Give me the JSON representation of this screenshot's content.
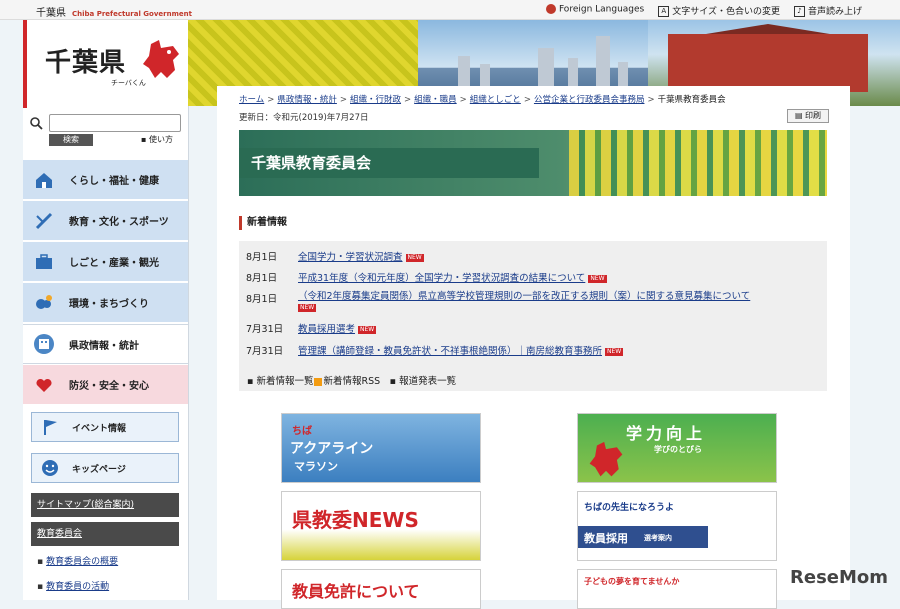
{
  "topbar": {
    "org_ja": "千葉県",
    "org_en": "Chiba Prefectural Government",
    "foreign_languages": "Foreign Languages",
    "font_size_color": "文字サイズ・色合いの変更",
    "read_aloud": "音声読み上げ"
  },
  "logo": {
    "title": "千葉県",
    "mascot_name": "チーバくん"
  },
  "search": {
    "button": "検索",
    "usage": "使い方"
  },
  "sidebar": {
    "menu": [
      {
        "label": "くらし・福祉・健康",
        "bg": "#cfe0f2",
        "icon": "house-icon"
      },
      {
        "label": "教育・文化・スポーツ",
        "bg": "#cfe0f2",
        "icon": "pen-icon"
      },
      {
        "label": "しごと・産業・観光",
        "bg": "#cfe0f2",
        "icon": "briefcase-icon"
      },
      {
        "label": "環境・まちづくり",
        "bg": "#cfe0f2",
        "icon": "weather-icon"
      },
      {
        "label": "県政情報・統計",
        "bg": "#ffffff",
        "icon": "building-icon"
      },
      {
        "label": "防災・安全・安心",
        "bg": "#f7d9de",
        "icon": "heart-icon"
      }
    ],
    "event": "イベント情報",
    "kids": "キッズページ",
    "sitemap": "サイトマップ(総合案内)",
    "committee": "教育委員会",
    "links": [
      "教育委員会の概要",
      "教育委員の活動"
    ]
  },
  "breadcrumb": [
    "ホーム",
    "県政情報・統計",
    "組織・行財政",
    "組織・職員",
    "組織としごと",
    "公営企業と行政委員会事務局",
    "千葉県教育委員会"
  ],
  "updated": "更新日：令和元(2019)年7月27日",
  "print": "印刷",
  "banner_title": "千葉県教育委員会",
  "news": {
    "heading": "新着情報",
    "items": [
      {
        "date": "8月1日",
        "text": "全国学力・学習状況調査",
        "new": "NEW"
      },
      {
        "date": "8月1日",
        "text": "平成31年度（令和元年度）全国学力・学習状況調査の結果について",
        "new": "NEW"
      },
      {
        "date": "8月1日",
        "text": "（令和2年度募集定員関係）県立高等学校管理規則の一部を改正する規則（案）に関する意見募集について",
        "new": "NEW"
      },
      {
        "date": "7月31日",
        "text": "教員採用選考",
        "new": "NEW"
      },
      {
        "date": "7月31日",
        "text": "管理課（講師登録・教員免許状・不祥事根絶関係）｜南房総教育事務所",
        "new": "NEW"
      }
    ],
    "list_link": "新着情報一覧",
    "rss_link": "新着情報RSS",
    "press_link": "報道発表一覧"
  },
  "banners": {
    "aqualine_top": "ちば",
    "aqualine_main": "アクアライン",
    "aqualine_sub": "マラソン",
    "gakuryoku": "学力向上",
    "gakuryoku_sub": "学びのとびら",
    "news": "県教委NEWS",
    "teacher_top": "ちばの先生になろうよ",
    "teacher_main": "教員採用",
    "teacher_sub": "選考案内",
    "license": "教員免許について",
    "dream": "子どもの夢を育てませんか"
  },
  "watermark": "ReseMom"
}
